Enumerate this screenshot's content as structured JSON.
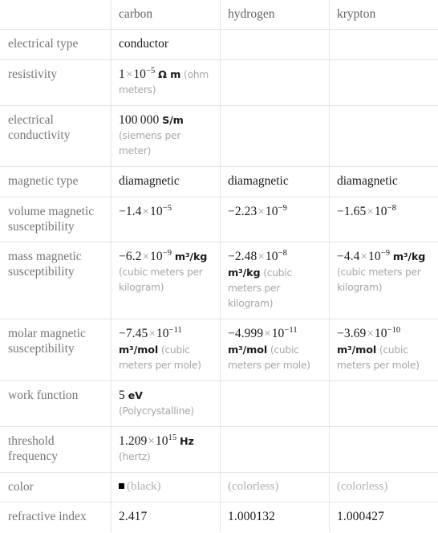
{
  "table": {
    "columns": [
      "",
      "carbon",
      "hydrogen",
      "krypton"
    ],
    "rows": [
      {
        "label": "electrical type",
        "carbon": {
          "value": "conductor",
          "kind": "word"
        },
        "hydrogen": {
          "value": ""
        },
        "krypton": {
          "value": ""
        }
      },
      {
        "label": "resistivity",
        "carbon": {
          "mantissa": "1",
          "times": "×",
          "base": "10",
          "exp": "−5",
          "unit": "Ω m",
          "paren": "(ohm meters)"
        },
        "hydrogen": {
          "value": ""
        },
        "krypton": {
          "value": ""
        }
      },
      {
        "label": "electrical conductivity",
        "carbon": {
          "mantissa": "100 000",
          "unit": "S/m",
          "paren": "(siemens per meter)"
        },
        "hydrogen": {
          "value": ""
        },
        "krypton": {
          "value": ""
        }
      },
      {
        "label": "magnetic type",
        "carbon": {
          "value": "diamagnetic",
          "kind": "word"
        },
        "hydrogen": {
          "value": "diamagnetic",
          "kind": "word"
        },
        "krypton": {
          "value": "diamagnetic",
          "kind": "word"
        }
      },
      {
        "label": "volume magnetic susceptibility",
        "carbon": {
          "mantissa": "−1.4",
          "times": "×",
          "base": "10",
          "exp": "−5"
        },
        "hydrogen": {
          "mantissa": "−2.23",
          "times": "×",
          "base": "10",
          "exp": "−9"
        },
        "krypton": {
          "mantissa": "−1.65",
          "times": "×",
          "base": "10",
          "exp": "−8"
        }
      },
      {
        "label": "mass magnetic susceptibility",
        "carbon": {
          "mantissa": "−6.2",
          "times": "×",
          "base": "10",
          "exp": "−9",
          "unit": "m³/kg",
          "paren": "(cubic meters per kilogram)"
        },
        "hydrogen": {
          "mantissa": "−2.48",
          "times": "×",
          "base": "10",
          "exp": "−8",
          "unit": "m³/kg",
          "paren": "(cubic meters per kilogram)"
        },
        "krypton": {
          "mantissa": "−4.4",
          "times": "×",
          "base": "10",
          "exp": "−9",
          "unit": "m³/kg",
          "paren": "(cubic meters per kilogram)"
        }
      },
      {
        "label": "molar magnetic susceptibility",
        "carbon": {
          "mantissa": "−7.45",
          "times": "×",
          "base": "10",
          "exp": "−11",
          "unit": "m³/mol",
          "paren": "(cubic meters per mole)"
        },
        "hydrogen": {
          "mantissa": "−4.999",
          "times": "×",
          "base": "10",
          "exp": "−11",
          "unit": "m³/mol",
          "paren": "(cubic meters per mole)"
        },
        "krypton": {
          "mantissa": "−3.69",
          "times": "×",
          "base": "10",
          "exp": "−10",
          "unit": "m³/mol",
          "paren": "(cubic meters per mole)"
        }
      },
      {
        "label": "work function",
        "carbon": {
          "mantissa": "5",
          "unit": "eV",
          "paren": "(Polycrystalline)"
        },
        "hydrogen": {
          "value": ""
        },
        "krypton": {
          "value": ""
        }
      },
      {
        "label": "threshold frequency",
        "carbon": {
          "mantissa": "1.209",
          "times": "×",
          "base": "10",
          "exp": "15",
          "unit": "Hz",
          "paren": "(hertz)"
        },
        "hydrogen": {
          "value": ""
        },
        "krypton": {
          "value": ""
        }
      },
      {
        "label": "color",
        "carbon": {
          "swatch": "#000000",
          "parenSerif": "(black)"
        },
        "hydrogen": {
          "parenSerif": "(colorless)",
          "center": true
        },
        "krypton": {
          "parenSerif": "(colorless)",
          "center": true
        }
      },
      {
        "label": "refractive index",
        "carbon": {
          "mantissa": "2.417"
        },
        "hydrogen": {
          "mantissa": "1.000132"
        },
        "krypton": {
          "mantissa": "1.000427"
        }
      }
    ]
  },
  "colors": {
    "border": "#e4e4e4",
    "label_text": "#767676",
    "header_text": "#61656b",
    "value_text": "#1b1b1b",
    "paren_text": "#a6a6a6",
    "swatch_black": "#000000"
  }
}
